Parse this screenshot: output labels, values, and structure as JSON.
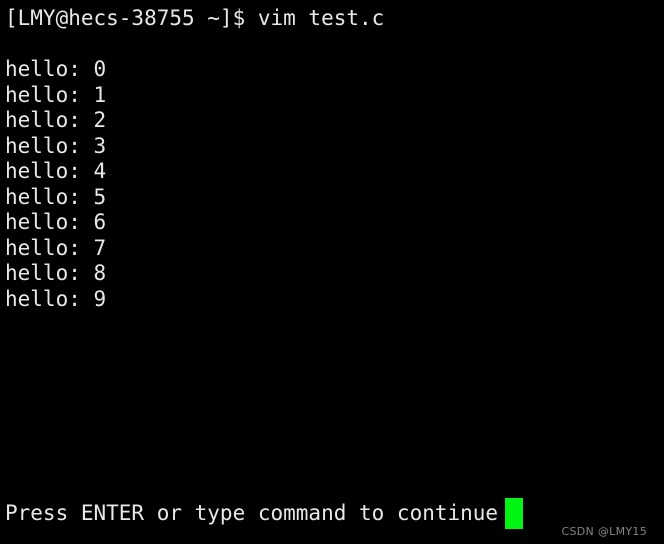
{
  "terminal": {
    "background_color": "#000000",
    "foreground_color": "#e8e8e8",
    "cursor_color": "#00f514",
    "prompt_line": "[LMY@hecs-38755 ~]$ vim test.c",
    "output_lines": [
      "hello: 0",
      "hello: 1",
      "hello: 2",
      "hello: 3",
      "hello: 4",
      "hello: 5",
      "hello: 6",
      "hello: 7",
      "hello: 8",
      "hello: 9"
    ],
    "status_message": "Press ENTER or type command to continue",
    "cursor": {
      "name": "block-cursor",
      "visible": true
    }
  },
  "watermark": {
    "text": "CSDN @LMY15"
  }
}
